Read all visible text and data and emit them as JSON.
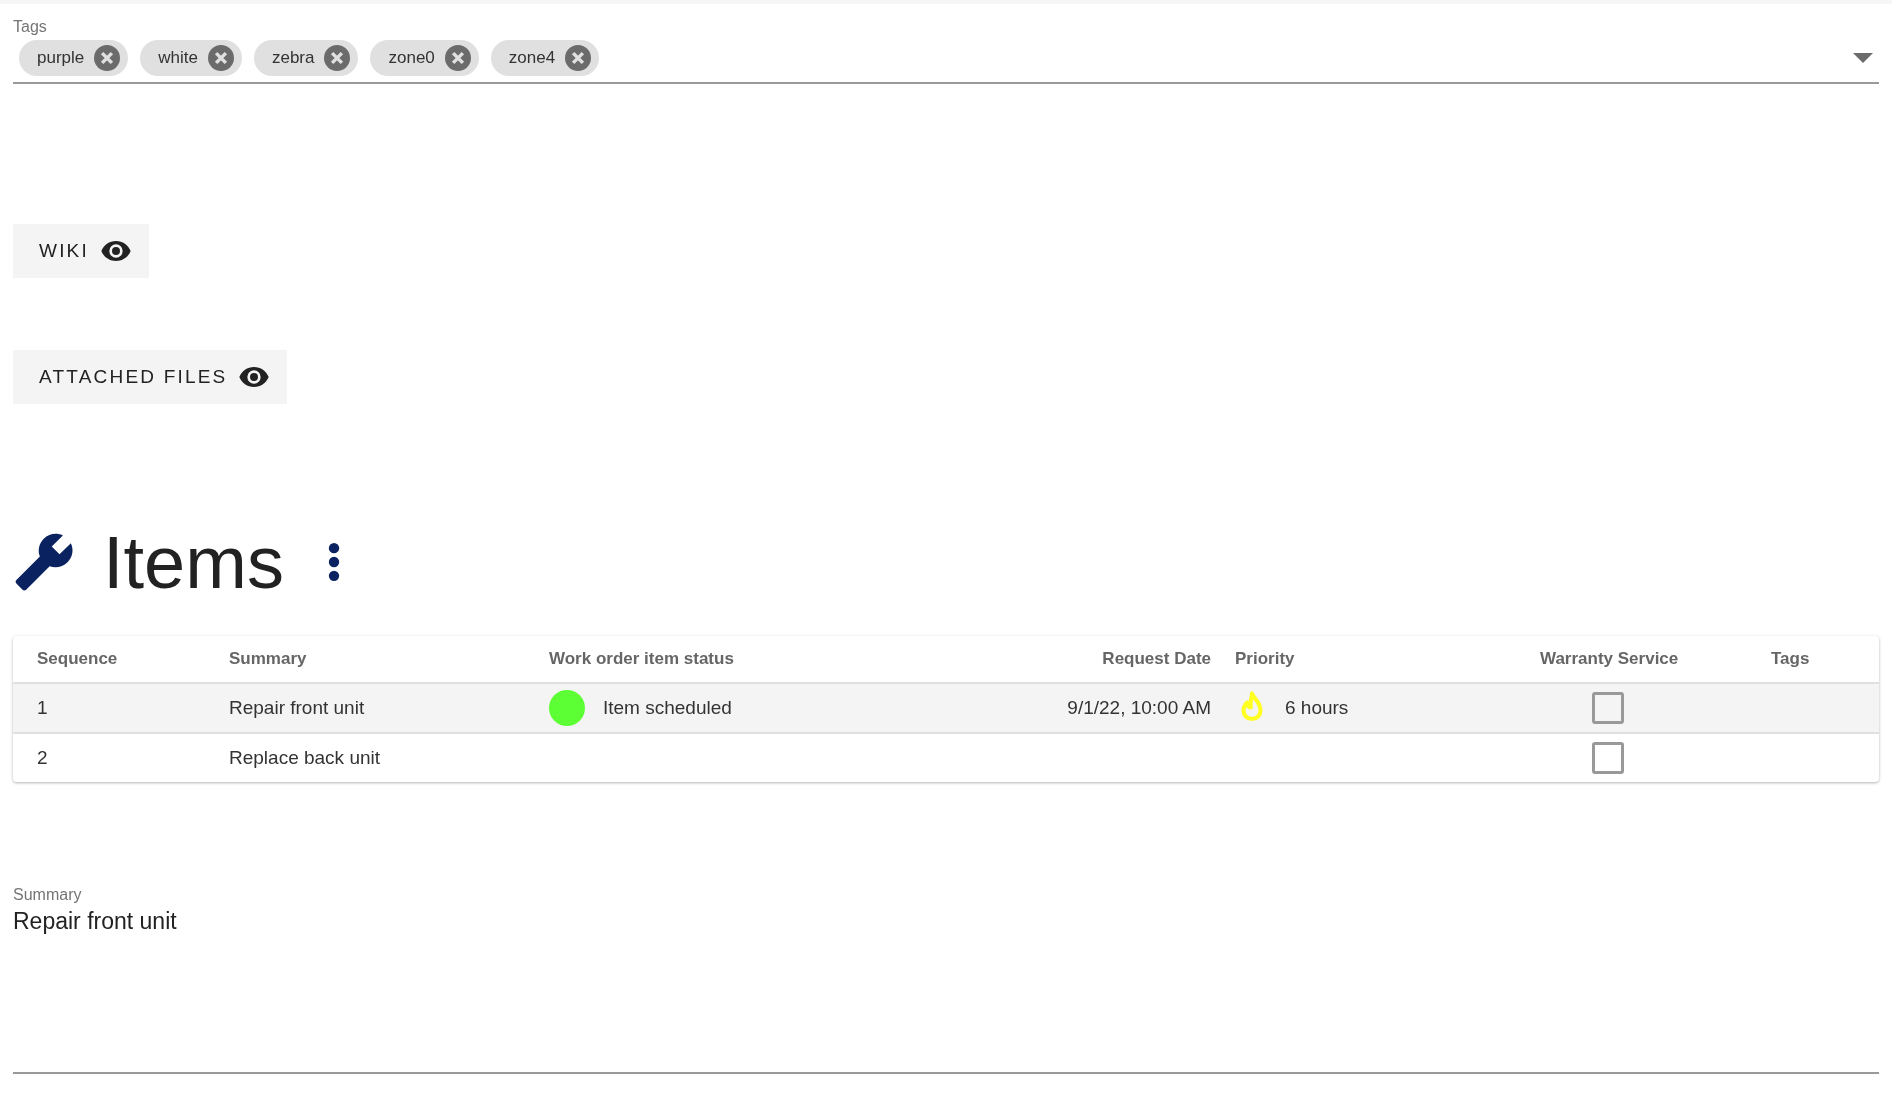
{
  "tags_field": {
    "label": "Tags",
    "chips": [
      {
        "label": "purple"
      },
      {
        "label": "white"
      },
      {
        "label": "zebra"
      },
      {
        "label": "zone0"
      },
      {
        "label": "zone4"
      }
    ]
  },
  "sections": [
    {
      "label": "WIKI"
    },
    {
      "label": "ATTACHED FILES"
    }
  ],
  "items": {
    "title": "Items",
    "table": {
      "columns": [
        "Sequence",
        "Summary",
        "Work order item status",
        "Request Date",
        "Priority",
        "Warranty Service",
        "Tags"
      ],
      "rows": [
        {
          "selected": true,
          "sequence": "1",
          "summary": "Repair front unit",
          "status": {
            "label": "Item scheduled",
            "color": "#5cff33"
          },
          "request_date": "9/1/22, 10:00 AM",
          "priority": "6 hours",
          "warranty_service": {
            "checked": false
          }
        },
        {
          "selected": false,
          "sequence": "2",
          "summary": "Replace back unit",
          "warranty_service": {
            "checked": false
          }
        }
      ]
    }
  },
  "summary_field": {
    "label": "Summary",
    "value": "Repair front unit"
  }
}
